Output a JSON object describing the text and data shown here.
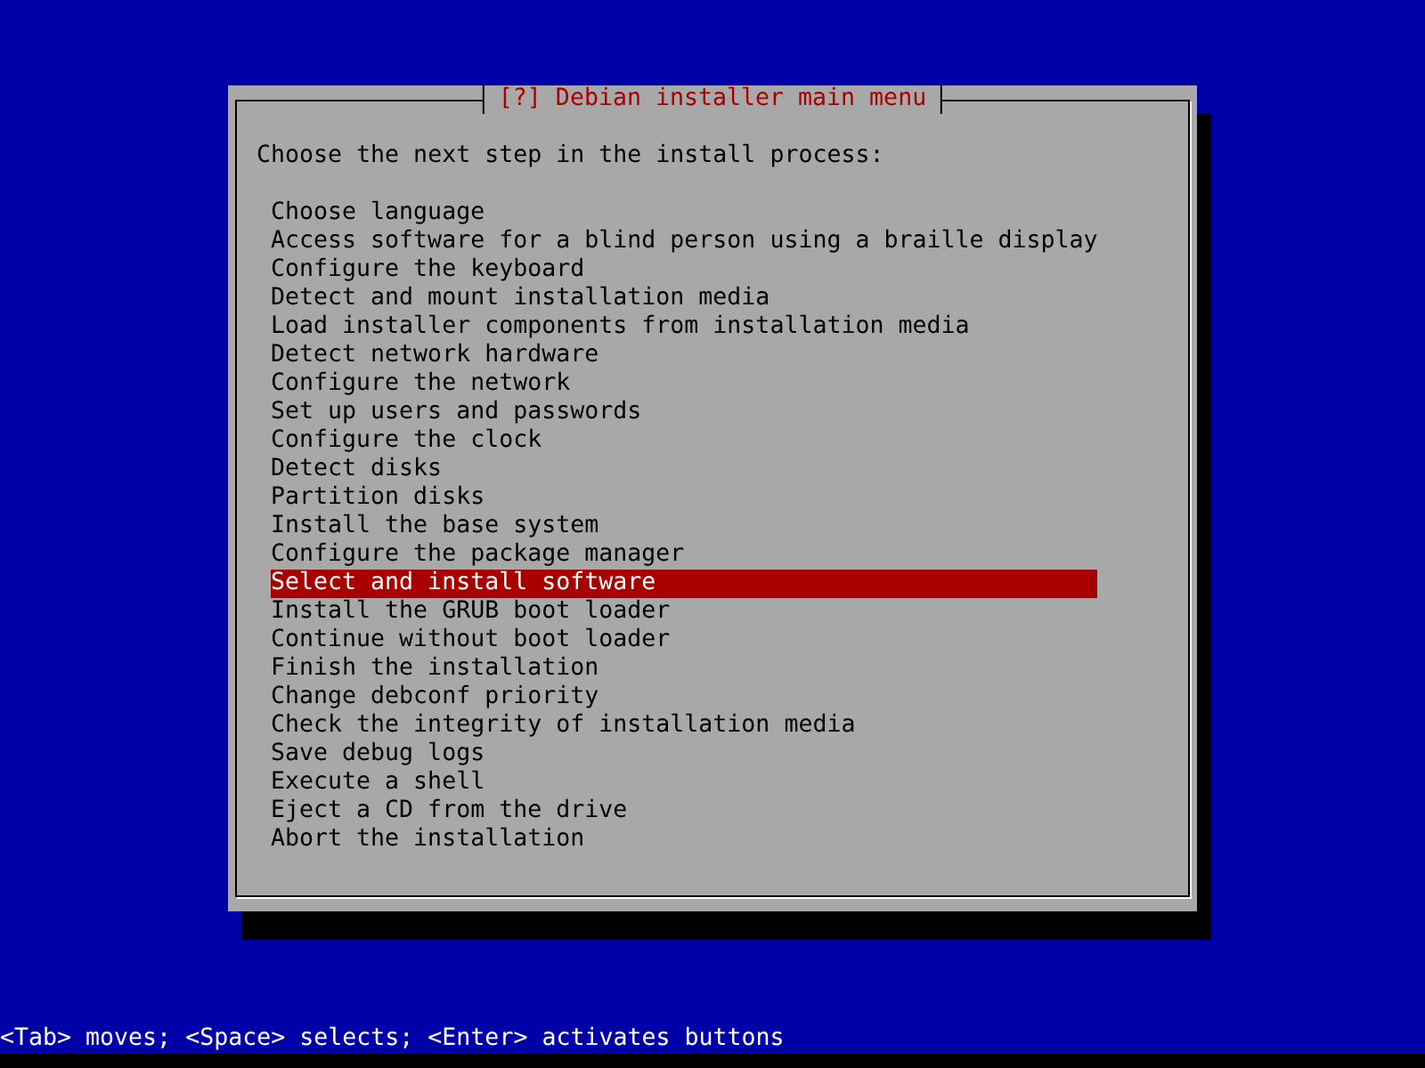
{
  "dialog": {
    "title": "[?] Debian installer main menu",
    "prompt": "Choose the next step in the install process:",
    "items": [
      {
        "label": "Choose language",
        "selected": false
      },
      {
        "label": "Access software for a blind person using a braille display",
        "selected": false
      },
      {
        "label": "Configure the keyboard",
        "selected": false
      },
      {
        "label": "Detect and mount installation media",
        "selected": false
      },
      {
        "label": "Load installer components from installation media",
        "selected": false
      },
      {
        "label": "Detect network hardware",
        "selected": false
      },
      {
        "label": "Configure the network",
        "selected": false
      },
      {
        "label": "Set up users and passwords",
        "selected": false
      },
      {
        "label": "Configure the clock",
        "selected": false
      },
      {
        "label": "Detect disks",
        "selected": false
      },
      {
        "label": "Partition disks",
        "selected": false
      },
      {
        "label": "Install the base system",
        "selected": false
      },
      {
        "label": "Configure the package manager",
        "selected": false
      },
      {
        "label": "Select and install software",
        "selected": true
      },
      {
        "label": "Install the GRUB boot loader",
        "selected": false
      },
      {
        "label": "Continue without boot loader",
        "selected": false
      },
      {
        "label": "Finish the installation",
        "selected": false
      },
      {
        "label": "Change debconf priority",
        "selected": false
      },
      {
        "label": "Check the integrity of installation media",
        "selected": false
      },
      {
        "label": "Save debug logs",
        "selected": false
      },
      {
        "label": "Execute a shell",
        "selected": false
      },
      {
        "label": "Eject a CD from the drive",
        "selected": false
      },
      {
        "label": "Abort the installation",
        "selected": false
      }
    ]
  },
  "status_bar": {
    "text": "<Tab> moves; <Space> selects; <Enter> activates buttons"
  }
}
